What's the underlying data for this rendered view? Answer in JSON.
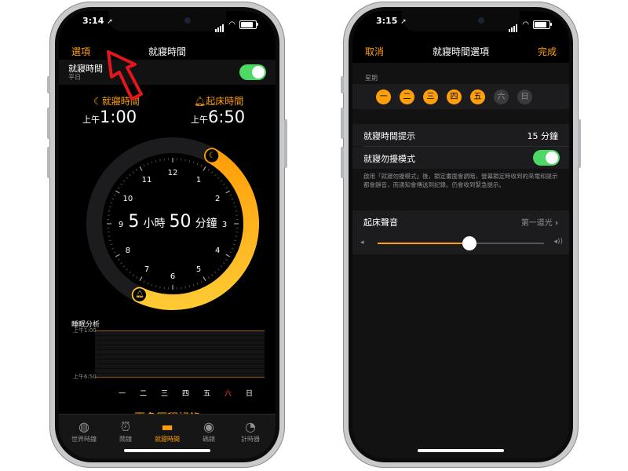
{
  "left_phone": {
    "status_time": "3:14",
    "nav": {
      "left": "選項",
      "title": "就寢時間"
    },
    "bedtime_row": {
      "title": "就寢時間",
      "subtitle": "平日"
    },
    "bedtime": {
      "label": "就寢時間",
      "period": "上午",
      "time": "1:00"
    },
    "wake": {
      "label": "起床時間",
      "period": "上午",
      "time": "6:50"
    },
    "duration": {
      "hours": "5",
      "hours_unit": "小時",
      "minutes": "50",
      "minutes_unit": "分鐘"
    },
    "dial_numbers": [
      "12",
      "1",
      "2",
      "3",
      "4",
      "5",
      "6",
      "7",
      "8",
      "9",
      "10",
      "11"
    ],
    "analysis": {
      "title": "睡眠分析",
      "top_period": "上午",
      "top_time": "1:00",
      "bottom_period": "上午",
      "bottom_time": "6:50",
      "days": [
        "一",
        "二",
        "三",
        "四",
        "五",
        "六",
        "日"
      ]
    },
    "more_history": "更多歷程記錄",
    "tabs": [
      {
        "label": "世界時鐘",
        "icon": "globe-icon"
      },
      {
        "label": "鬧鐘",
        "icon": "alarm-clock-icon"
      },
      {
        "label": "就寢時間",
        "icon": "bed-icon"
      },
      {
        "label": "碼錶",
        "icon": "stopwatch-icon"
      },
      {
        "label": "計時器",
        "icon": "timer-icon"
      }
    ]
  },
  "right_phone": {
    "status_time": "3:15",
    "nav": {
      "left": "取消",
      "title": "就寢時間選項",
      "right": "完成"
    },
    "weekday_header": "星期",
    "weekdays": [
      {
        "label": "一",
        "on": true
      },
      {
        "label": "二",
        "on": true
      },
      {
        "label": "三",
        "on": true
      },
      {
        "label": "四",
        "on": true
      },
      {
        "label": "五",
        "on": true
      },
      {
        "label": "六",
        "on": false
      },
      {
        "label": "日",
        "on": false
      }
    ],
    "reminder": {
      "label": "就寢時間提示",
      "value": "15 分鐘"
    },
    "dnd": {
      "label": "就寢勿擾模式"
    },
    "dnd_footer": "啟用「就寢勿擾模式」後，鎖定畫面會調暗，螢幕鎖定時收到的來電和提示都會靜音，而通知會傳送到記錄。仍會收到緊急提示。",
    "wake_sound": {
      "label": "起床聲音",
      "value": "第一道光"
    },
    "volume_level": 0.55
  },
  "colors": {
    "accent": "#ff9f0a",
    "toggle_on": "#4cd964",
    "annotation": "#e3161b"
  }
}
